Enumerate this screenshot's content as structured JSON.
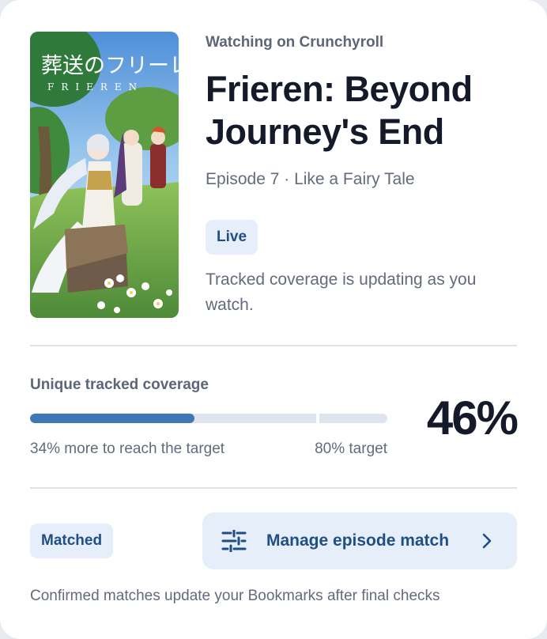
{
  "header": {
    "source": "Watching on Crunchyroll",
    "title": "Frieren: Beyond Journey's End",
    "episode": "Episode 7 · Like a Fairy Tale",
    "status_badge": "Live",
    "status_note": "Tracked coverage is updating as you watch."
  },
  "poster": {
    "title_japanese": "葬送のフリーレン",
    "title_latin": "FRIEREN"
  },
  "coverage": {
    "label": "Unique tracked coverage",
    "percent_value": 46,
    "percent_text": "46%",
    "target_value": 80,
    "remaining_text": "34% more to reach the target",
    "target_text": "80% target"
  },
  "footer": {
    "match_badge": "Matched",
    "manage_label": "Manage episode match",
    "footnote": "Confirmed matches update your Bookmarks after final checks"
  },
  "icons": {
    "manage": "sliders-icon",
    "chevron": "chevron-right-icon"
  },
  "colors": {
    "accent": "#3f77b8",
    "badge_bg": "#e6eef9",
    "badge_text": "#1f4f85"
  }
}
